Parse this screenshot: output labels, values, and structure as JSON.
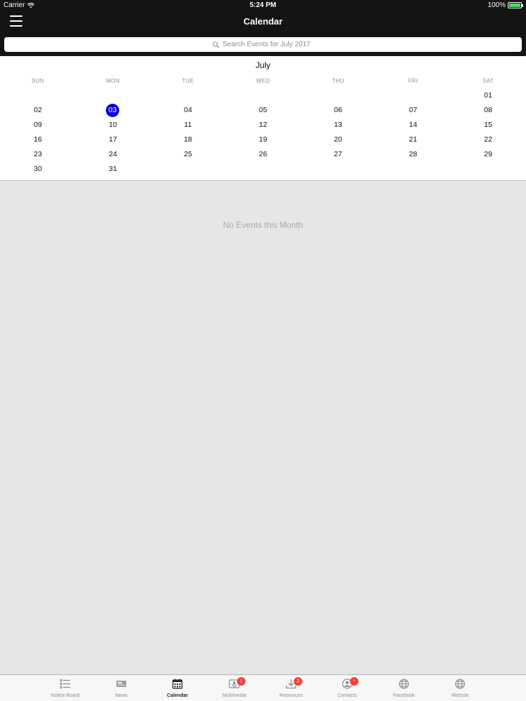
{
  "status_bar": {
    "carrier": "Carrier",
    "time": "5:24 PM",
    "battery": "100%"
  },
  "nav": {
    "title": "Calendar",
    "search_placeholder": "Search Events for July 2017"
  },
  "calendar": {
    "month": "July",
    "weekdays": [
      "SUN",
      "MON",
      "TUE",
      "WED",
      "THU",
      "FRI",
      "SAT"
    ],
    "selected_day": "03",
    "weeks": [
      [
        "",
        "",
        "",
        "",
        "",
        "",
        "01"
      ],
      [
        "02",
        "03",
        "04",
        "05",
        "06",
        "07",
        "08"
      ],
      [
        "09",
        "10",
        "11",
        "12",
        "13",
        "14",
        "15"
      ],
      [
        "16",
        "17",
        "18",
        "19",
        "20",
        "21",
        "22"
      ],
      [
        "23",
        "24",
        "25",
        "26",
        "27",
        "28",
        "29"
      ],
      [
        "30",
        "31",
        "",
        "",
        "",
        "",
        ""
      ]
    ]
  },
  "events": {
    "empty_message": "No Events this Month"
  },
  "tabs": [
    {
      "label": "Notice Board",
      "icon": "list-icon",
      "badge": ""
    },
    {
      "label": "News",
      "icon": "newspaper-icon",
      "badge": ""
    },
    {
      "label": "Calendar",
      "icon": "calendar-icon",
      "badge": "",
      "active": true
    },
    {
      "label": "Multimedia",
      "icon": "microphone-icon",
      "badge": "1"
    },
    {
      "label": "Resources",
      "icon": "download-icon",
      "badge": "2"
    },
    {
      "label": "Contacts",
      "icon": "contacts-icon",
      "badge": "*"
    },
    {
      "label": "Facebook",
      "icon": "globe-icon",
      "badge": ""
    },
    {
      "label": "Website",
      "icon": "globe-icon",
      "badge": ""
    }
  ],
  "colors": {
    "selected_day": "#0a00d8",
    "badge": "#ff3b30",
    "battery": "#4cd964",
    "header": "#141414"
  }
}
